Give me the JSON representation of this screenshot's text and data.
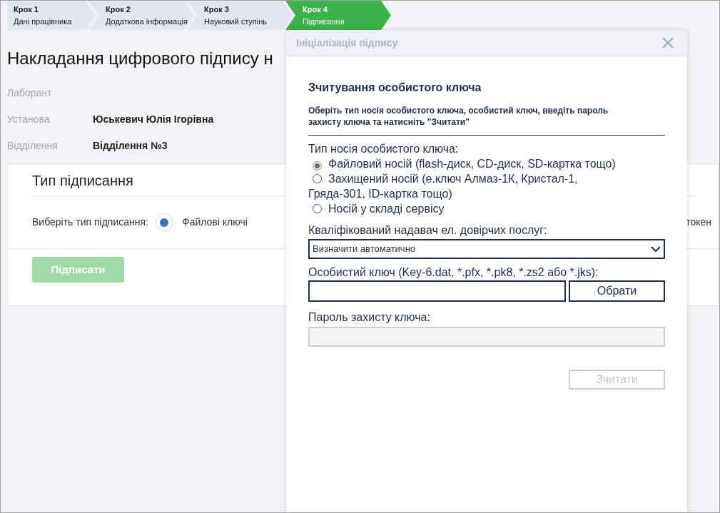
{
  "steps": [
    {
      "step": "Крок 1",
      "label": "Дані працівника",
      "selected": false
    },
    {
      "step": "Крок 2",
      "label": "Додаткова інформація",
      "selected": false
    },
    {
      "step": "Крок 3",
      "label": "Науковий ступінь",
      "selected": false
    },
    {
      "step": "Крок 4",
      "label": "Підписання",
      "selected": true
    }
  ],
  "page": {
    "title": "Накладання цифрового підпису н",
    "fields": [
      {
        "label": "Лаборант"
      },
      {
        "label": "Установа",
        "value": "Юськевич Юлія Ігорівна"
      },
      {
        "label": "Відділення",
        "value": "Відділення №3"
      }
    ],
    "signing_card": {
      "title": "Тип підписання",
      "prompt": "Виберіть тип підписання:",
      "options": [
        {
          "label": "Файлові ключі",
          "selected": true
        }
      ],
      "cut_text": "токен",
      "button": {
        "label": "Підписати",
        "disabled": true
      }
    }
  },
  "dialog": {
    "title": "Ініціалізація підпису",
    "heading": "Зчитування особистого ключа",
    "instruction": "Оберіть тип носія особистого ключа, особистий ключ, введіть пароль захисту ключа та натисніть \"Зчитати\"",
    "media_label": "Тип носія особистого ключа:",
    "media_options": [
      {
        "label": "Файловий носій (flash-диск, CD-диск, SD-картка тощо)",
        "selected": true
      },
      {
        "label": "Захищений носій (е.ключ Алмаз-1К, Кристал-1,",
        "continuation": "Гряда-301, ID-картка тощо)",
        "selected": false
      },
      {
        "label": "Носій у складі сервісу",
        "selected": false
      }
    ],
    "provider_label": "Кваліфікований надавач ел. довірчих послуг:",
    "provider_value": "Визначити автоматично",
    "key_label": "Особистий ключ (Key-6.dat, *.pfx, *.pk8, *.zs2 або *.jks):",
    "browse_button": "Обрати",
    "password_label": "Пароль захисту ключа:",
    "password_disabled": true,
    "read_button": {
      "label": "Зчитати",
      "disabled": true
    }
  }
}
